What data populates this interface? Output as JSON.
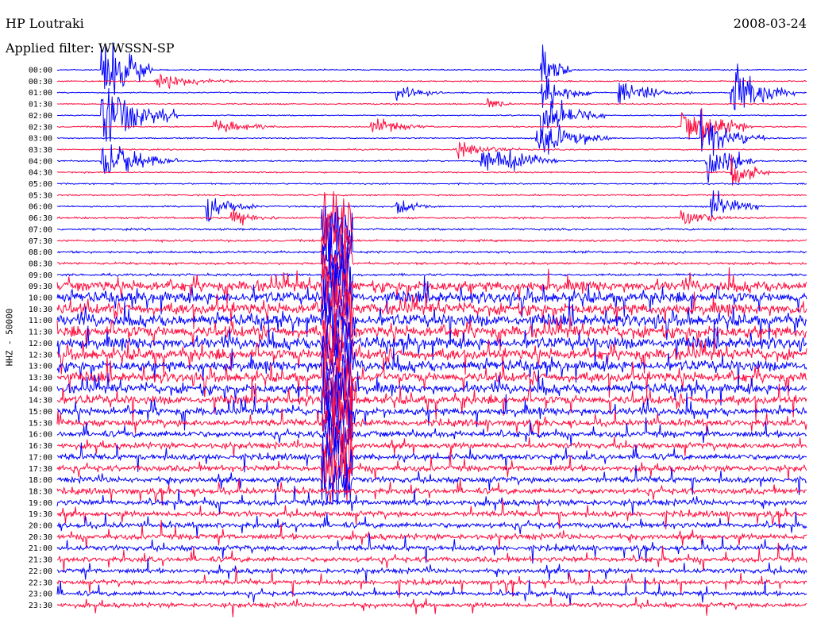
{
  "header": {
    "station": "HP Loutraki",
    "filter": "Applied filter: WWSSN-SP",
    "date": "2008-03-24"
  },
  "channel_label": "HHZ - 50000",
  "colors": {
    "trace_a": "#0000ff",
    "trace_b": "#ff0a3c",
    "background": "#ffffff",
    "text": "#000000"
  },
  "chart_data": {
    "type": "line",
    "title": "HP Loutraki",
    "subtitle": "Applied filter: WWSSN-SP",
    "ylabel": "HHZ - 50000",
    "xlabel": "",
    "grid": false,
    "legend": "none",
    "row_labels": [
      "00:00",
      "00:30",
      "01:00",
      "01:30",
      "02:00",
      "02:30",
      "03:00",
      "03:30",
      "04:00",
      "04:30",
      "05:00",
      "05:30",
      "06:00",
      "06:30",
      "07:00",
      "07:30",
      "08:00",
      "08:30",
      "09:00",
      "09:30",
      "10:00",
      "10:30",
      "11:00",
      "11:30",
      "12:00",
      "12:30",
      "13:00",
      "13:30",
      "14:00",
      "14:30",
      "15:00",
      "15:30",
      "16:00",
      "16:30",
      "17:00",
      "17:30",
      "18:00",
      "18:30",
      "19:00",
      "19:30",
      "20:00",
      "20:30",
      "21:00",
      "21:30",
      "22:00",
      "22:30",
      "23:00",
      "23:30"
    ],
    "row_colors": [
      "blue",
      "red"
    ],
    "noise_level": [
      0.18,
      0.2,
      0.18,
      0.2,
      0.18,
      0.2,
      0.2,
      0.22,
      0.22,
      0.22,
      0.22,
      0.24,
      0.25,
      0.28,
      0.3,
      0.32,
      0.34,
      0.36,
      0.38,
      1.6,
      1.7,
      1.75,
      1.8,
      1.8,
      1.75,
      1.7,
      1.6,
      1.5,
      1.4,
      1.3,
      1.1,
      1.0,
      0.95,
      0.9,
      0.9,
      0.9,
      0.9,
      0.9,
      0.9,
      0.85,
      0.85,
      0.85,
      0.8,
      0.8,
      0.75,
      0.7,
      0.7,
      0.7
    ],
    "events": [
      {
        "row": 0,
        "minute": 1.8,
        "amplitude": 26,
        "duration": 2.0
      },
      {
        "row": 0,
        "minute": 19.4,
        "amplitude": 14,
        "duration": 1.2
      },
      {
        "row": 1,
        "minute": 4.0,
        "amplitude": 5,
        "duration": 3.0
      },
      {
        "row": 2,
        "minute": 13.6,
        "amplitude": 6,
        "duration": 2.0
      },
      {
        "row": 2,
        "minute": 22.5,
        "amplitude": 6,
        "duration": 3.0
      },
      {
        "row": 2,
        "minute": 19.4,
        "amplitude": 12,
        "duration": 2.0
      },
      {
        "row": 2,
        "minute": 27.0,
        "amplitude": 16,
        "duration": 2.5
      },
      {
        "row": 3,
        "minute": 17.2,
        "amplitude": 4,
        "duration": 1.0
      },
      {
        "row": 4,
        "minute": 1.8,
        "amplitude": 20,
        "duration": 3.0
      },
      {
        "row": 4,
        "minute": 19.4,
        "amplitude": 14,
        "duration": 2.5
      },
      {
        "row": 5,
        "minute": 6.3,
        "amplitude": 5,
        "duration": 2.5
      },
      {
        "row": 5,
        "minute": 12.6,
        "amplitude": 5,
        "duration": 2.5
      },
      {
        "row": 5,
        "minute": 25.0,
        "amplitude": 12,
        "duration": 2.5
      },
      {
        "row": 5,
        "minute": 25.8,
        "amplitude": 10,
        "duration": 2.0
      },
      {
        "row": 6,
        "minute": 19.2,
        "amplitude": 12,
        "duration": 3.0
      },
      {
        "row": 6,
        "minute": 25.8,
        "amplitude": 14,
        "duration": 2.5
      },
      {
        "row": 7,
        "minute": 16.0,
        "amplitude": 5,
        "duration": 2.5
      },
      {
        "row": 8,
        "minute": 1.8,
        "amplitude": 12,
        "duration": 3.0
      },
      {
        "row": 8,
        "minute": 26.0,
        "amplitude": 16,
        "duration": 2.0
      },
      {
        "row": 8,
        "minute": 17.0,
        "amplitude": 12,
        "duration": 3.0
      },
      {
        "row": 9,
        "minute": 27.0,
        "amplitude": 10,
        "duration": 1.5
      },
      {
        "row": 12,
        "minute": 6.0,
        "amplitude": 8,
        "duration": 2.0
      },
      {
        "row": 12,
        "minute": 13.6,
        "amplitude": 6,
        "duration": 1.5
      },
      {
        "row": 12,
        "minute": 26.2,
        "amplitude": 10,
        "duration": 2.0
      },
      {
        "row": 13,
        "minute": 25.0,
        "amplitude": 6,
        "duration": 2.0
      },
      {
        "row": 13,
        "minute": 7.0,
        "amplitude": 5,
        "duration": 2.0
      }
    ],
    "continuous_bursts": [
      {
        "minute": 11.2,
        "from_row": 13,
        "to_row": 36,
        "amplitude": 4.0
      }
    ]
  }
}
